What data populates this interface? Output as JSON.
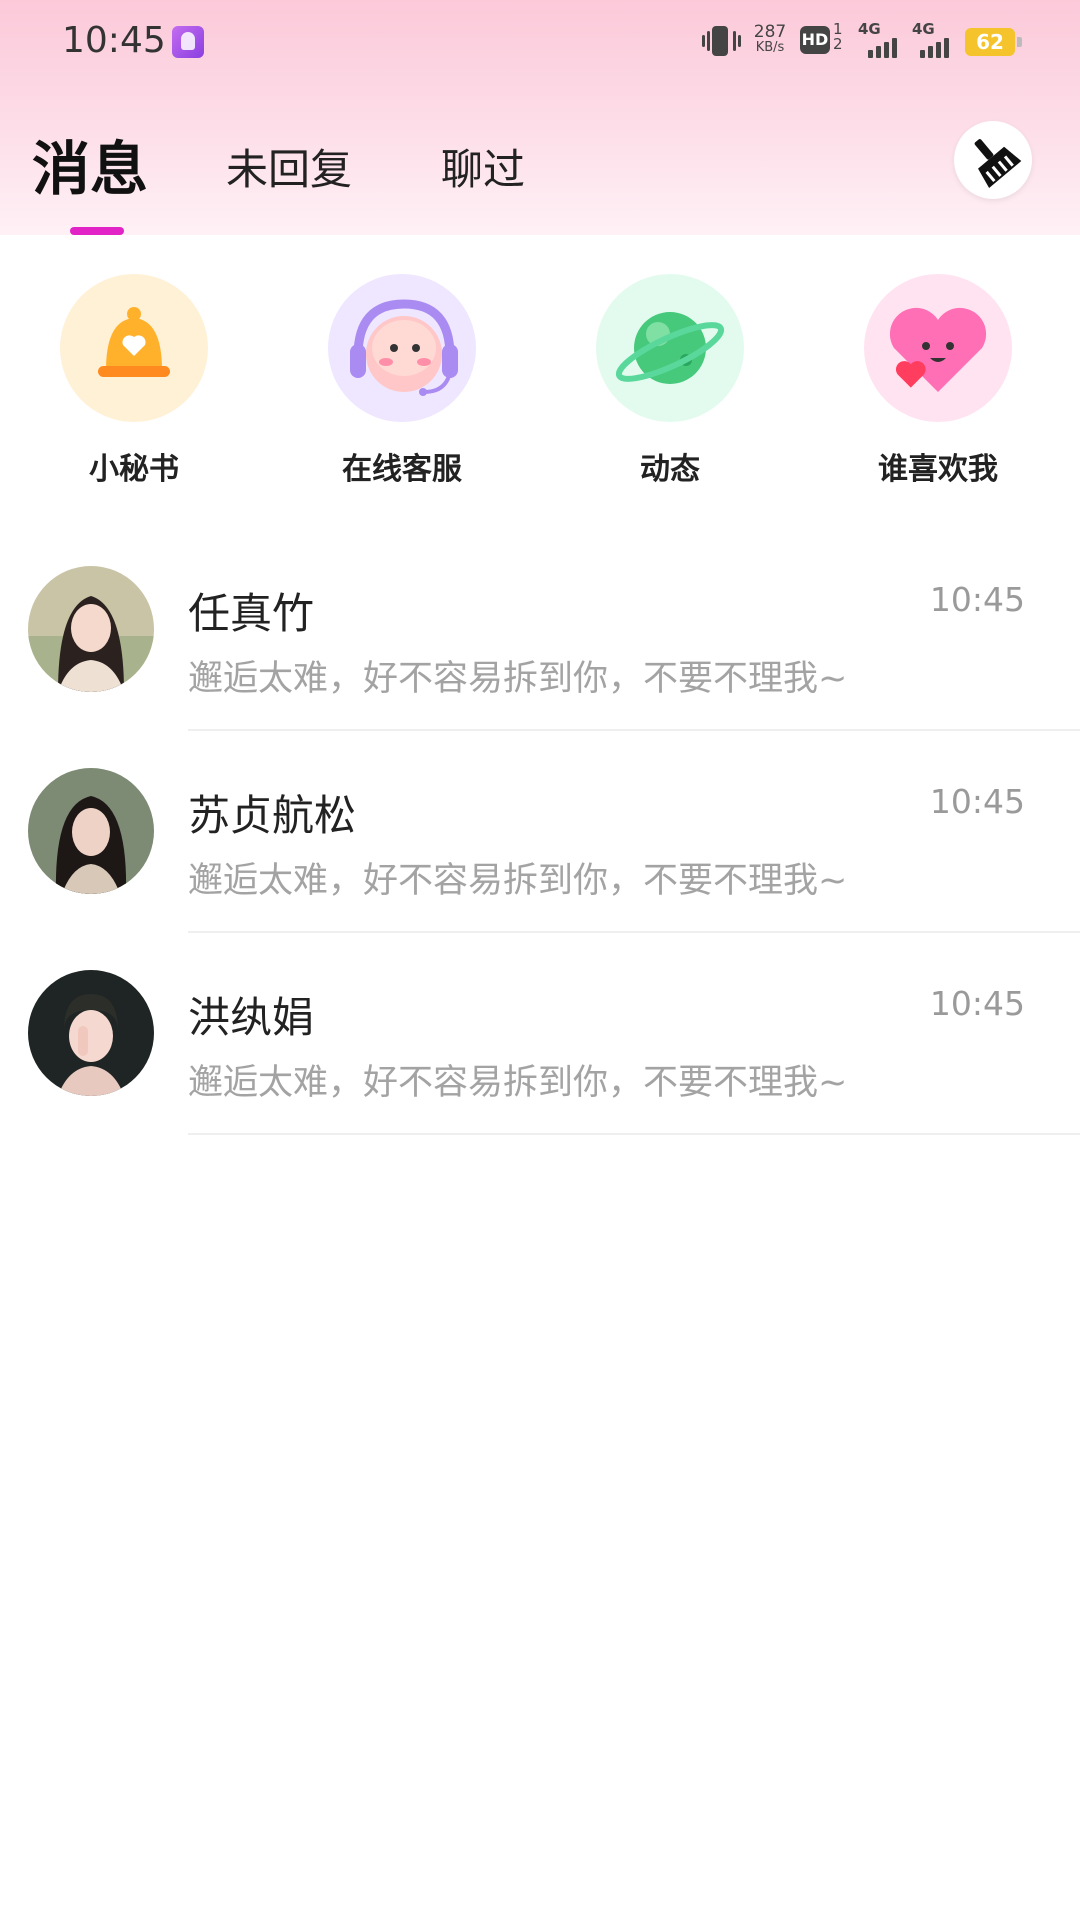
{
  "status_bar": {
    "time": "10:45",
    "net_speed_value": "287",
    "net_speed_unit": "KB/s",
    "hd_label": "HD",
    "hd_sub": "1\n2",
    "network_1": "4G",
    "network_2": "4G",
    "battery": "62"
  },
  "tabs": [
    {
      "label": "消息",
      "active": true
    },
    {
      "label": "未回复",
      "active": false
    },
    {
      "label": "聊过",
      "active": false
    }
  ],
  "colors": {
    "accent": "#e224c7",
    "header_gradient_top": "#fcc9d9",
    "battery": "#f5c42c"
  },
  "quick_entries": [
    {
      "label": "小秘书",
      "icon": "bell-icon"
    },
    {
      "label": "在线客服",
      "icon": "headset-mascot-icon"
    },
    {
      "label": "动态",
      "icon": "planet-icon"
    },
    {
      "label": "谁喜欢我",
      "icon": "heart-face-icon"
    }
  ],
  "messages": [
    {
      "name": "任真竹",
      "time": "10:45",
      "preview": "邂逅太难，好不容易拆到你，不要不理我~"
    },
    {
      "name": "苏贞航松",
      "time": "10:45",
      "preview": "邂逅太难，好不容易拆到你，不要不理我~"
    },
    {
      "name": "洪纨娟",
      "time": "10:45",
      "preview": "邂逅太难，好不容易拆到你，不要不理我~"
    }
  ]
}
